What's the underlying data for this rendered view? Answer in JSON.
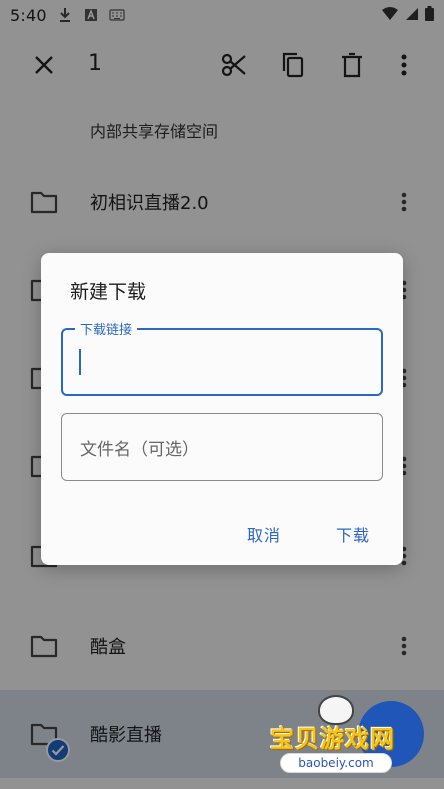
{
  "status_bar": {
    "time": "5:40",
    "icons": [
      "download-icon",
      "a-icon",
      "keyboard-icon",
      "wifi-icon",
      "signal-icon",
      "battery-icon"
    ]
  },
  "action_bar": {
    "selected_count": "1",
    "icons": [
      "close-icon",
      "cut-icon",
      "copy-icon",
      "delete-icon",
      "more-vert-icon"
    ]
  },
  "path_label": "内部共享存储空间",
  "files": [
    {
      "name": "初相识直播2.0",
      "selected": false
    },
    {
      "name": "",
      "selected": false
    },
    {
      "name": "",
      "selected": false
    },
    {
      "name": "",
      "selected": false
    },
    {
      "name": "",
      "selected": false
    },
    {
      "name": "酷盒",
      "selected": false
    },
    {
      "name": "酷影直播",
      "selected": true
    }
  ],
  "dialog": {
    "title": "新建下载",
    "url_field": {
      "label": "下载链接",
      "value": ""
    },
    "filename_field": {
      "placeholder": "文件名（可选）"
    },
    "cancel_label": "取消",
    "download_label": "下载"
  },
  "watermark": {
    "text": "宝贝游戏网",
    "url": "baobeiy.com"
  },
  "colors": {
    "accent": "#2b67c6",
    "selected_row": "#d3dbe7",
    "watermark_gold": "#f5c518"
  }
}
